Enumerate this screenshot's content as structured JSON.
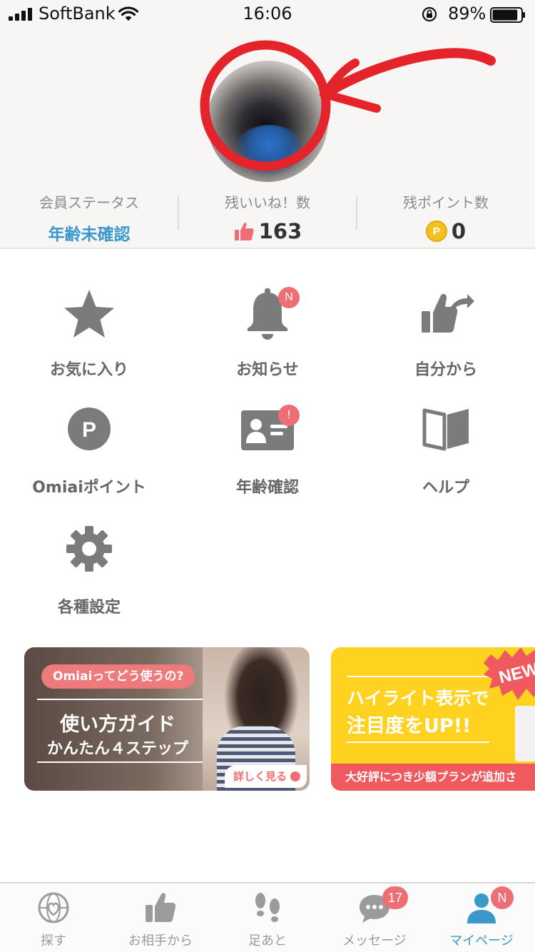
{
  "status_bar": {
    "carrier": "SoftBank",
    "time": "16:06",
    "battery_percent": "89%",
    "battery_level": 0.89,
    "icons": [
      "signal-icon",
      "wifi-icon",
      "rotation-lock-icon",
      "battery-icon"
    ]
  },
  "profile": {
    "stats": {
      "member_status": {
        "label": "会員ステータス",
        "value": "年齢未確認"
      },
      "likes_remaining": {
        "label": "残いいね！数",
        "value": "163",
        "icon": "thumbs-up-icon"
      },
      "points_remaining": {
        "label": "残ポイント数",
        "value": "0",
        "icon": "coin-icon",
        "coin_letter": "P"
      }
    }
  },
  "menu": [
    {
      "label": "お気に入り",
      "icon": "star-icon"
    },
    {
      "label": "お知らせ",
      "icon": "bell-icon",
      "badge": "N"
    },
    {
      "label": "自分から",
      "icon": "thumbs-up-share-icon"
    },
    {
      "label": "Omiaiポイント",
      "icon": "point-icon",
      "icon_letter": "P"
    },
    {
      "label": "年齢確認",
      "icon": "id-card-icon",
      "badge": "!"
    },
    {
      "label": "ヘルプ",
      "icon": "book-icon"
    },
    {
      "label": "各種設定",
      "icon": "gear-icon"
    }
  ],
  "banners": {
    "guide": {
      "tag": "Omiaiってどう使うの?",
      "title": "使い方ガイド",
      "subtitle": "かんたん４ステップ",
      "more": "詳しく見る"
    },
    "highlight": {
      "line1": "ハイライト表示で",
      "line2": "注目度をUP!!",
      "footer": "大好評につき少額プランが追加さ",
      "new_label": "NEW"
    }
  },
  "tabs": [
    {
      "label": "探す",
      "icon": "globe-heart-icon"
    },
    {
      "label": "お相手から",
      "icon": "thumbs-up-icon"
    },
    {
      "label": "足あと",
      "icon": "footprints-icon"
    },
    {
      "label": "メッセージ",
      "icon": "chat-icon",
      "badge": "17"
    },
    {
      "label": "マイページ",
      "icon": "person-icon",
      "badge": "N",
      "active": true
    }
  ],
  "colors": {
    "accent_blue": "#3a98cb",
    "badge_red": "#ee6f73",
    "annotation_red": "#e4232b",
    "icon_gray": "#7b7b7b",
    "highlight_yellow": "#ffd21f"
  }
}
